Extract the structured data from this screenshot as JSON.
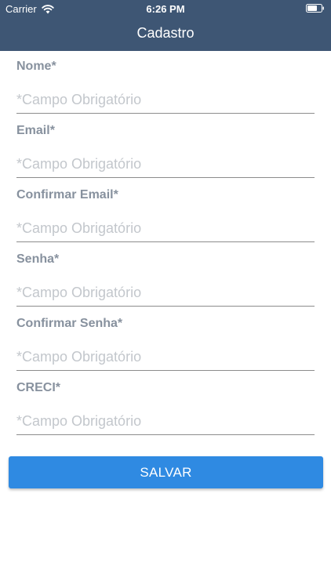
{
  "status_bar": {
    "carrier": "Carrier",
    "time": "6:26 PM",
    "wifi_icon": "wifi-icon",
    "battery_icon": "battery-icon"
  },
  "nav": {
    "title": "Cadastro",
    "background_color": "#3e5674"
  },
  "form": {
    "fields": [
      {
        "label": "Nome*",
        "placeholder": "*Campo Obrigatório",
        "value": ""
      },
      {
        "label": "Email*",
        "placeholder": "*Campo Obrigatório",
        "value": ""
      },
      {
        "label": "Confirmar Email*",
        "placeholder": "*Campo Obrigatório",
        "value": ""
      },
      {
        "label": "Senha*",
        "placeholder": "*Campo Obrigatório",
        "value": ""
      },
      {
        "label": "Confirmar Senha*",
        "placeholder": "*Campo Obrigatório",
        "value": ""
      },
      {
        "label": "CRECI*",
        "placeholder": "*Campo Obrigatório",
        "value": ""
      }
    ]
  },
  "actions": {
    "save_label": "SALVAR",
    "save_color": "#2f8ae2"
  }
}
